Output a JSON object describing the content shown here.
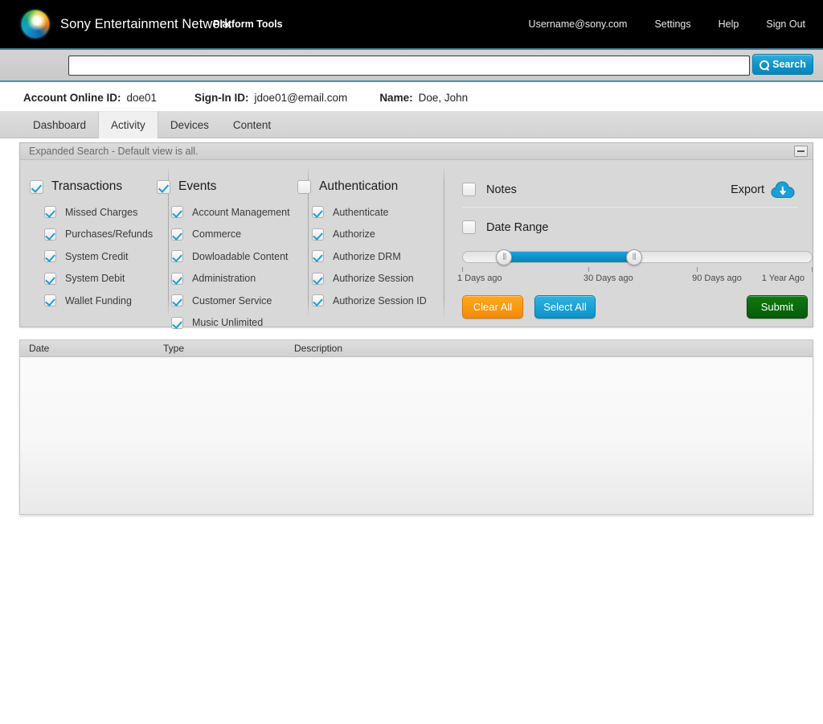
{
  "header": {
    "brand_name": "Sony Entertainment Network",
    "platform_tools": "Platform Tools",
    "logo_icon": "sony-sen-orb-logo",
    "nav": [
      {
        "label": "Username@sony.com",
        "name": "username-link"
      },
      {
        "label": "Settings",
        "name": "settings-link"
      },
      {
        "label": "Help",
        "name": "help-link"
      },
      {
        "label": "Sign Out",
        "name": "sign-out-link"
      }
    ]
  },
  "search": {
    "value": "",
    "placeholder": "",
    "button_label": "Search",
    "button_icon": "search-icon"
  },
  "account": {
    "online_id_label": "Account Online ID:",
    "online_id_value": "doe01",
    "signin_id_label": "Sign-In ID:",
    "signin_id_value": "jdoe01@email.com",
    "name_label": "Name:",
    "name_value": "Doe, John"
  },
  "tabs": [
    {
      "label": "Dashboard",
      "name": "tab-dashboard",
      "active": false
    },
    {
      "label": "Activity",
      "name": "tab-activity",
      "active": true
    },
    {
      "label": "Devices",
      "name": "tab-devices",
      "active": false
    },
    {
      "label": "Content",
      "name": "tab-content",
      "active": false
    }
  ],
  "expanded_search": {
    "title": "Expanded Search - Default view is all.",
    "collapse_icon": "minimize-icon",
    "groups": [
      {
        "title": "Transactions",
        "checked": true,
        "options": [
          {
            "label": "Missed Charges",
            "checked": true
          },
          {
            "label": "Purchases/Refunds",
            "checked": true
          },
          {
            "label": "System Credit",
            "checked": true
          },
          {
            "label": "System Debit",
            "checked": true
          },
          {
            "label": "Wallet Funding",
            "checked": true
          }
        ]
      },
      {
        "title": "Events",
        "checked": true,
        "options": [
          {
            "label": "Account Management",
            "checked": true
          },
          {
            "label": "Commerce",
            "checked": true
          },
          {
            "label": "Dowloadable Content",
            "checked": true
          },
          {
            "label": "Administration",
            "checked": true
          },
          {
            "label": "Customer Service",
            "checked": true
          },
          {
            "label": "Music Unlimited",
            "checked": true
          }
        ]
      },
      {
        "title": "Authentication",
        "checked": false,
        "options": [
          {
            "label": "Authenticate",
            "checked": true
          },
          {
            "label": "Authorize",
            "checked": true
          },
          {
            "label": "Authorize DRM",
            "checked": true
          },
          {
            "label": "Authorize Session",
            "checked": true
          },
          {
            "label": "Authorize Session ID",
            "checked": true
          }
        ]
      }
    ],
    "notes": {
      "label": "Notes",
      "checked": false
    },
    "export": {
      "label": "Export",
      "icon": "cloud-download-icon"
    },
    "date_range": {
      "label": "Date Range",
      "checked": false
    },
    "slider": {
      "low_handle_pct": 12,
      "high_handle_pct": 49,
      "ticks": [
        {
          "label": "1 Days ago",
          "pct": 0
        },
        {
          "label": "30 Days ago",
          "pct": 36
        },
        {
          "label": "90 Days ago",
          "pct": 67
        },
        {
          "label": "1 Year Ago",
          "pct": 100
        }
      ]
    },
    "buttons": {
      "clear_all": "Clear All",
      "select_all": "Select All",
      "submit": "Submit"
    }
  },
  "results": {
    "columns": [
      "Date",
      "Type",
      "Description"
    ],
    "rows": []
  },
  "colors": {
    "accent_blue": "#0e92c8",
    "orange": "#f58a06",
    "green": "#065c08",
    "header_black": "#000000",
    "panel_gray": "#d8d8d8"
  }
}
